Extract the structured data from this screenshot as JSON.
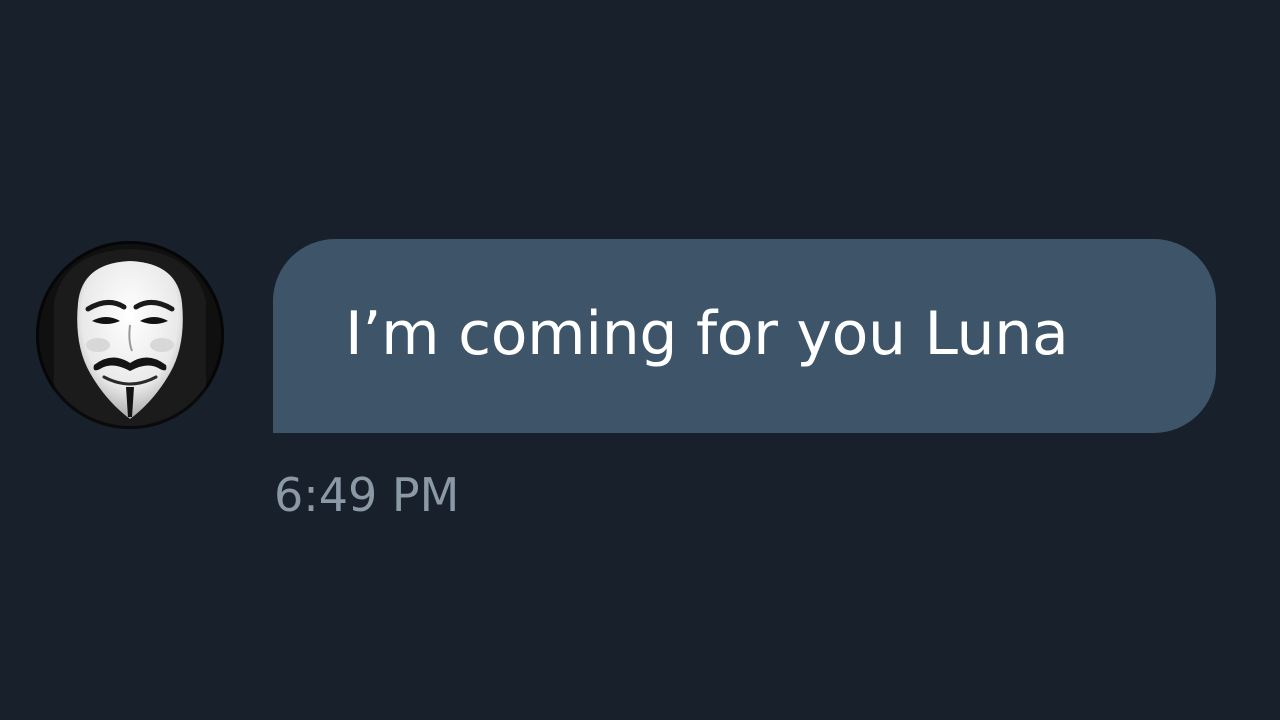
{
  "message": {
    "sender_avatar_icon": "guy-fawkes-mask-avatar",
    "text": "I’m coming for you Luna",
    "timestamp": "6:49 PM"
  },
  "colors": {
    "background": "#17202b",
    "bubble": "#3e5569",
    "message_text": "#ffffff",
    "timestamp_text": "#8b98a5"
  }
}
